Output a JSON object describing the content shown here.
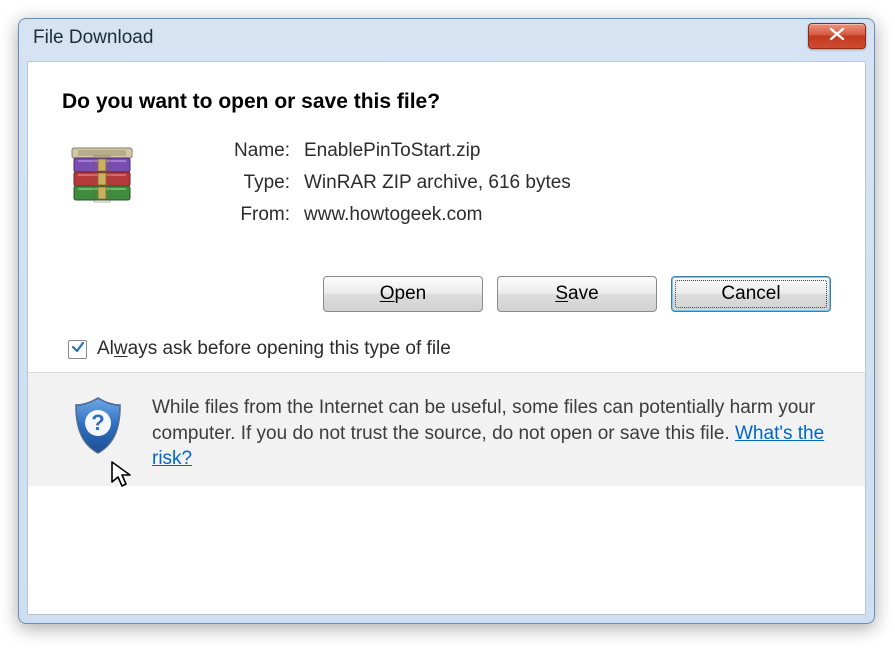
{
  "window": {
    "title": "File Download"
  },
  "heading": "Do you want to open or save this file?",
  "info": {
    "name_label": "Name:",
    "name_value": "EnablePinToStart.zip",
    "type_label": "Type:",
    "type_value": "WinRAR ZIP archive, 616 bytes",
    "from_label": "From:",
    "from_value": "www.howtogeek.com"
  },
  "buttons": {
    "open_pre": "",
    "open_u": "O",
    "open_post": "pen",
    "save_pre": "",
    "save_u": "S",
    "save_post": "ave",
    "cancel": "Cancel"
  },
  "checkbox": {
    "pre": "Al",
    "u": "w",
    "post": "ays ask before opening this type of file"
  },
  "warning": {
    "text": "While files from the Internet can be useful, some files can potentially harm your computer. If you do not trust the source, do not open or save this file. ",
    "link": "What's the risk?"
  }
}
